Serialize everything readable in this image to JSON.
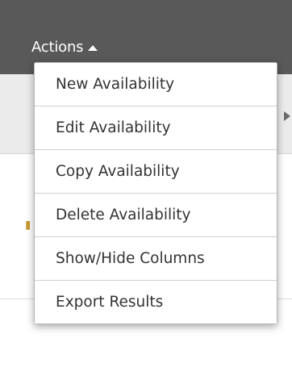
{
  "toolbar": {
    "actions_label": "Actions"
  },
  "actions_menu": {
    "items": [
      {
        "label": "New Availability"
      },
      {
        "label": "Edit Availability"
      },
      {
        "label": "Copy Availability"
      },
      {
        "label": "Delete Availability"
      },
      {
        "label": "Show/Hide Columns"
      },
      {
        "label": "Export Results"
      }
    ]
  },
  "colors": {
    "toolbar_bg": "#595959",
    "menu_bg": "#ffffff",
    "menu_text": "#333333"
  }
}
